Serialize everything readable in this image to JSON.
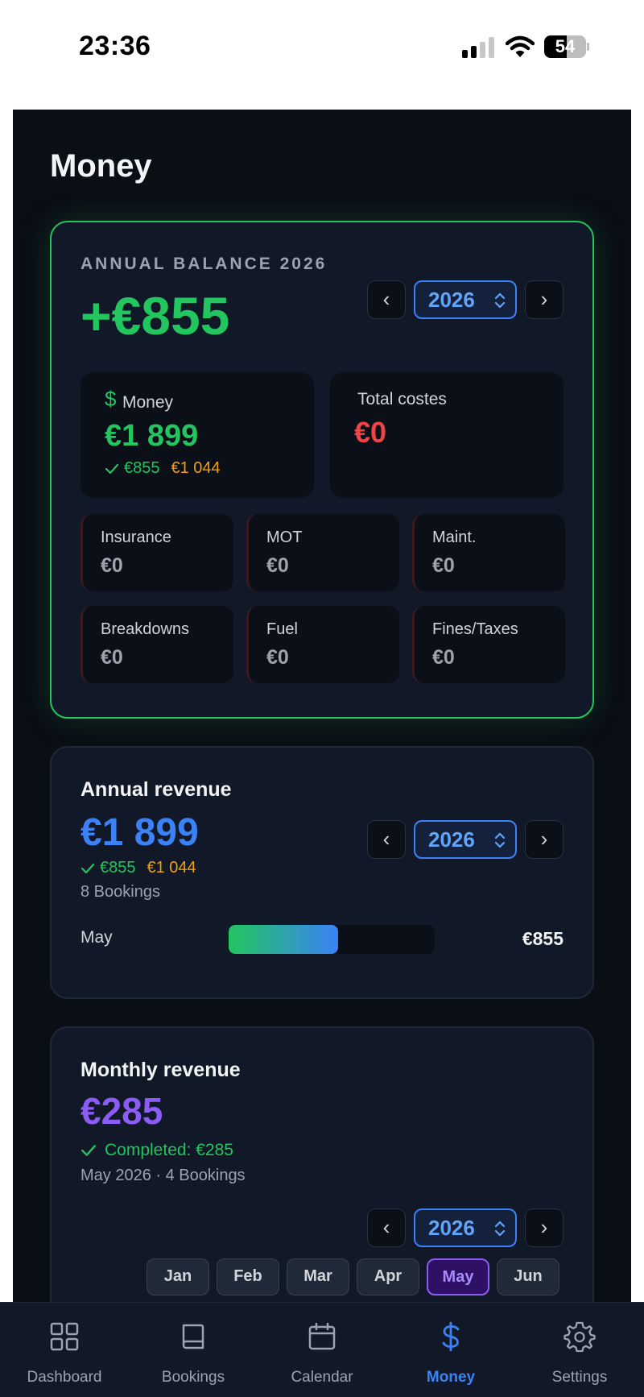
{
  "status_bar": {
    "time": "23:36",
    "battery": "54",
    "battery_level": 0.54
  },
  "page": {
    "title": "Money"
  },
  "balance_card": {
    "overline": "ANNUAL BALANCE 2026",
    "value": "+€855",
    "year": "2026",
    "money_tile": {
      "label": "Money",
      "value": "€1 899",
      "completed": "€855",
      "pending": "€1 044"
    },
    "costs_tile": {
      "label": "Total costes",
      "value": "€0"
    },
    "cost_items": [
      {
        "label": "Insurance",
        "value": "€0"
      },
      {
        "label": "MOT",
        "value": "€0"
      },
      {
        "label": "Maint.",
        "value": "€0"
      },
      {
        "label": "Breakdowns",
        "value": "€0"
      },
      {
        "label": "Fuel",
        "value": "€0"
      },
      {
        "label": "Fines/Taxes",
        "value": "€0"
      }
    ]
  },
  "annual_card": {
    "title": "Annual revenue",
    "value": "€1 899",
    "completed": "€855",
    "pending": "€1 044",
    "bookings": "8 Bookings",
    "year": "2026",
    "bar": {
      "label": "May",
      "amount": "€855",
      "fraction": 0.53
    }
  },
  "monthly_card": {
    "title": "Monthly revenue",
    "value": "€285",
    "completed": "Completed: €285",
    "meta": "May 2026 · 4 Bookings",
    "year": "2026",
    "months": [
      "Jan",
      "Feb",
      "Mar",
      "Apr",
      "May",
      "Jun"
    ],
    "active_month": "May"
  },
  "tabs": [
    {
      "label": "Dashboard",
      "icon": "grid-icon"
    },
    {
      "label": "Bookings",
      "icon": "book-icon"
    },
    {
      "label": "Calendar",
      "icon": "calendar-icon"
    },
    {
      "label": "Money",
      "icon": "dollar-icon",
      "active": true
    },
    {
      "label": "Settings",
      "icon": "gear-icon"
    }
  ],
  "colors": {
    "accent_green": "#22c55e",
    "accent_blue": "#3b82f6",
    "accent_purple": "#8b5cf6",
    "pending_orange": "#f59e0b",
    "cost_red": "#ef4444",
    "background": "#0a0e15"
  }
}
